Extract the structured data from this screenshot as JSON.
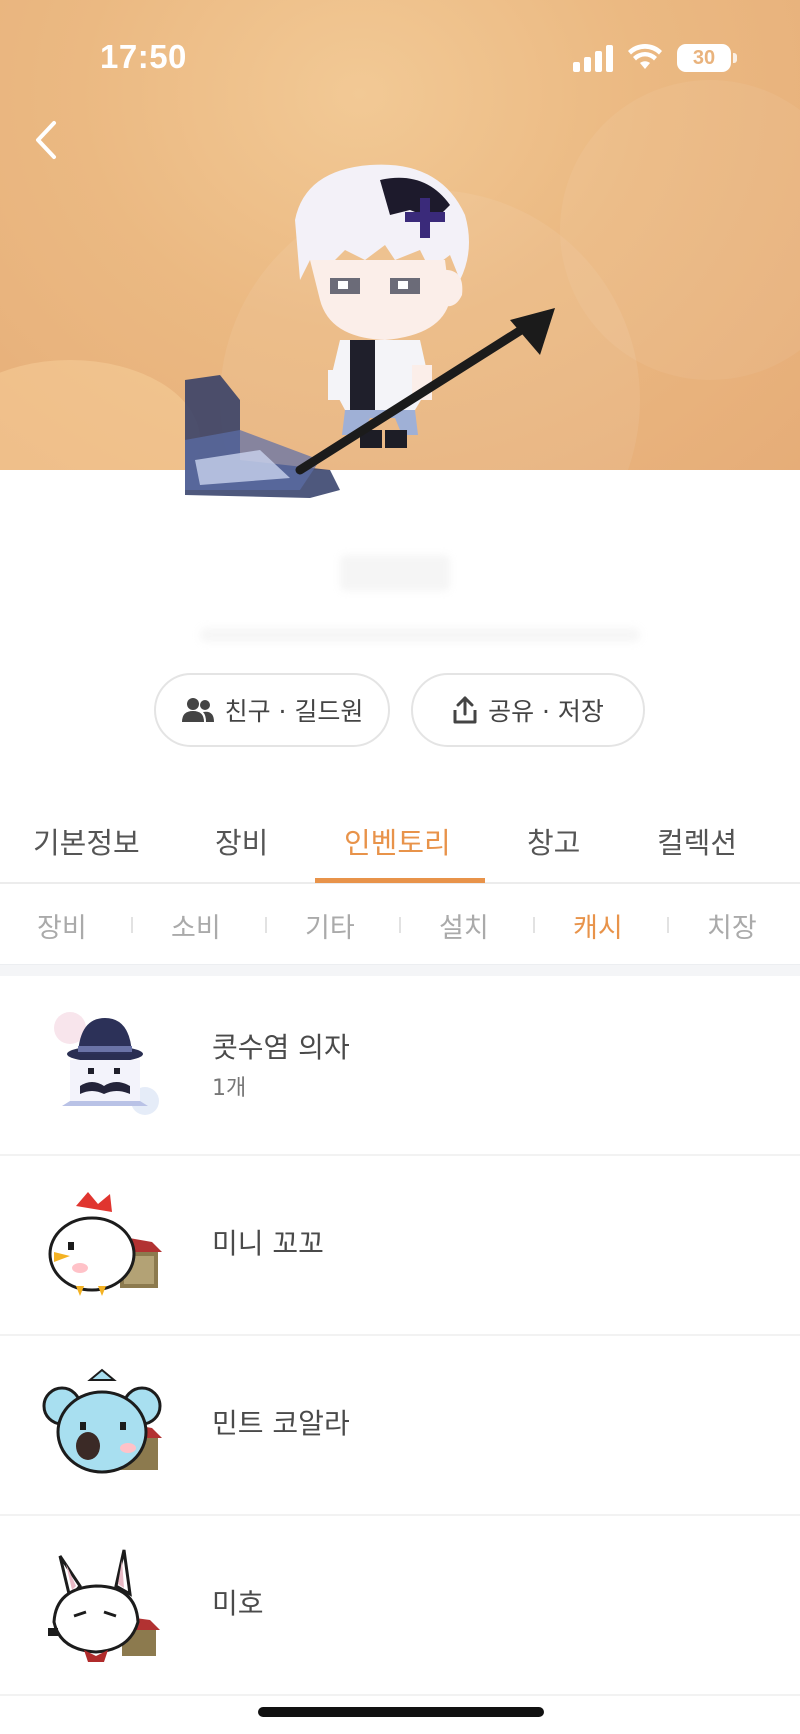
{
  "status_bar": {
    "time": "17:50",
    "battery": "30"
  },
  "profile": {
    "name": "",
    "subtitle": ""
  },
  "actions": {
    "friends_label": "친구 · 길드원",
    "share_label": "공유 · 저장"
  },
  "main_tabs": [
    {
      "label": "기본정보",
      "active": false
    },
    {
      "label": "장비",
      "active": false
    },
    {
      "label": "인벤토리",
      "active": true
    },
    {
      "label": "창고",
      "active": false
    },
    {
      "label": "컬렉션",
      "active": false
    }
  ],
  "sub_tabs": [
    {
      "label": "장비",
      "active": false
    },
    {
      "label": "소비",
      "active": false
    },
    {
      "label": "기타",
      "active": false
    },
    {
      "label": "설치",
      "active": false
    },
    {
      "label": "캐시",
      "active": true
    },
    {
      "label": "치장",
      "active": false
    }
  ],
  "items": [
    {
      "name": "콧수염 의자",
      "count": "1개",
      "icon": "mustache-chair-icon"
    },
    {
      "name": "미니 꼬꼬",
      "count": "",
      "icon": "chicken-pet-icon"
    },
    {
      "name": "민트 코알라",
      "count": "",
      "icon": "koala-pet-icon"
    },
    {
      "name": "미호",
      "count": "",
      "icon": "fox-pet-icon"
    }
  ],
  "colors": {
    "accent": "#e8934a",
    "hero_background": "#ebb982",
    "inactive_text": "#aaaaaa"
  }
}
